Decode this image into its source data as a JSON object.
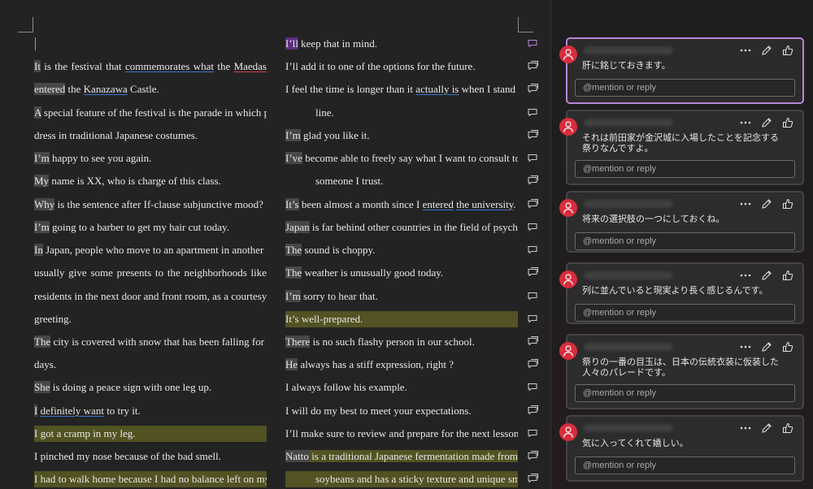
{
  "document": {
    "left_column": [
      {
        "lead": "It",
        "text": " is the festival that commemorates what the Maedas",
        "justify": true
      },
      {
        "lead": "entered",
        "text": " the Kanazawa Castle.",
        "justify": false
      },
      {
        "lead": "A",
        "text": " special feature of the festival is the parade in which people",
        "justify": true
      },
      {
        "lead": "",
        "text": "dress in traditional Japanese costumes.",
        "justify": false
      },
      {
        "lead": "I’m",
        "text": " happy to see you again.",
        "justify": false
      },
      {
        "lead": "My",
        "text": " name is XX, who is charge of this class.",
        "justify": false
      },
      {
        "lead": "Why",
        "text": " is the sentence after If-clause subjunctive mood?",
        "justify": false
      },
      {
        "lead": "I’m",
        "text": " going to a barber to get my hair cut today.",
        "justify": false
      },
      {
        "lead": "In",
        "text": " Japan, people who move to an apartment in another city",
        "justify": true
      },
      {
        "lead": "",
        "text": "usually give some presents to the neighborhoods like",
        "justify": true
      },
      {
        "lead": "",
        "text": "residents in the next door and front room, as a courtesy",
        "justify": true
      },
      {
        "lead": "",
        "text": "greeting.",
        "justify": false
      },
      {
        "lead": "The",
        "text": " city is covered with snow that has been falling for three",
        "justify": true
      },
      {
        "lead": "",
        "text": "days.",
        "justify": false
      },
      {
        "lead": "She",
        "text": " is doing a peace sign with one leg up.",
        "justify": false
      },
      {
        "lead": "I",
        "text": " definitely want to try it.",
        "justify": false
      },
      {
        "lead": "",
        "text": "I got a cramp in my leg.",
        "justify": false,
        "highlight": true
      },
      {
        "lead": "",
        "text": "I pinched my nose because of the bad smell.",
        "justify": false
      },
      {
        "lead": "",
        "text": "I had to walk home because I had no balance left on my IC",
        "justify": true,
        "highlight": true
      }
    ],
    "right_column": [
      {
        "lead": "I’ll",
        "text": " keep that in mind.",
        "justify": false,
        "purple": true
      },
      {
        "lead": "",
        "text": "I’ll add it to one of the options for the future.",
        "justify": false
      },
      {
        "lead": "",
        "text": "I feel the time is longer than it actually is when I stand in",
        "justify": true
      },
      {
        "lead": "",
        "text": "line.",
        "justify": false,
        "indent": true
      },
      {
        "lead": "I’m",
        "text": " glad you like it.",
        "justify": false
      },
      {
        "lead": "I’ve",
        "text": " become able to freely say what I want to consult to",
        "justify": true
      },
      {
        "lead": "",
        "text": "someone I trust.",
        "justify": false,
        "indent": true
      },
      {
        "lead": "It’s",
        "text": " been almost a month since I entered the university.",
        "justify": false
      },
      {
        "lead": "Japan",
        "text": " is far behind other countries in the field of psychology.",
        "justify": false
      },
      {
        "lead": "The",
        "text": " sound is choppy.",
        "justify": false
      },
      {
        "lead": "The",
        "text": " weather is unusually good today.",
        "justify": false
      },
      {
        "lead": "I’m",
        "text": " sorry to hear that.",
        "justify": false
      },
      {
        "lead": "",
        "text": "It’s well-prepared.",
        "justify": false,
        "highlight": true
      },
      {
        "lead": "There",
        "text": " is no such flashy person in our school.",
        "justify": false
      },
      {
        "lead": "He",
        "text": " always has a stiff expression, right ?",
        "justify": false
      },
      {
        "lead": "",
        "text": "I always follow his example.",
        "justify": false
      },
      {
        "lead": "",
        "text": "I will do my best to meet your expectations.",
        "justify": false
      },
      {
        "lead": "",
        "text": "I’ll make sure to review and prepare for the next lesson.",
        "justify": false
      },
      {
        "lead": "Natto",
        "text": " is a traditional Japanese fermentation made from",
        "justify": true,
        "highlight_after_lead": true
      },
      {
        "lead": "",
        "text": "soybeans and has a sticky texture and unique smell.",
        "justify": true,
        "indent": true,
        "highlight": true
      }
    ]
  },
  "comments": [
    {
      "text": "肝に銘じておきます。",
      "reply_placeholder": "@mention or reply",
      "active": true
    },
    {
      "text": "それは前田家が金沢城に入場したことを記念する祭りなんですよ。",
      "reply_placeholder": "@mention or reply"
    },
    {
      "text": "将来の選択肢の一つにしておくね。",
      "reply_placeholder": "@mention or reply"
    },
    {
      "text": "列に並んでいると現実より長く感じるんです。",
      "reply_placeholder": "@mention or reply"
    },
    {
      "text": "祭りの一番の目玉は、日本の伝統衣装に仮装した人々のパレードです。",
      "reply_placeholder": "@mention or reply"
    },
    {
      "text": "気に入ってくれて嬉しい。",
      "reply_placeholder": "@mention or reply"
    }
  ],
  "icons": {
    "comment_marker": "comment-icon",
    "more": "more-options-icon",
    "edit": "pencil-icon",
    "like": "thumbs-up-icon",
    "avatar": "person-icon"
  },
  "colors": {
    "highlight": "#8c8c23",
    "active_comment_border": "#b784d8",
    "avatar": "#d82d3c",
    "underline_blue": "#3a78d6",
    "underline_red": "#d8423c"
  }
}
